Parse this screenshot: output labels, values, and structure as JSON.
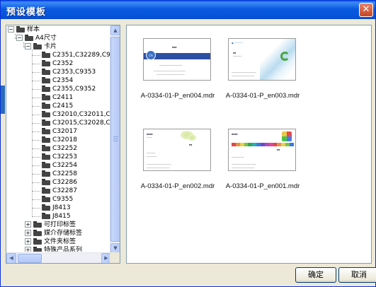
{
  "window": {
    "title": "预设模板",
    "close_icon": "close-icon"
  },
  "tree": {
    "root": "样本",
    "a4": "A4尺寸",
    "card": "卡片",
    "items": [
      "C2351,C32289,C9",
      "C2352",
      "C2353,C9353",
      "C2354",
      "C2355,C9352",
      "C2411",
      "C2415",
      "C32010,C32011,C",
      "C32015,C32028,C",
      "C32017",
      "C32018",
      "C32252",
      "C32253",
      "C32254",
      "C32258",
      "C32286",
      "C32287",
      "C9355",
      "J8413",
      "J8415"
    ],
    "categories": [
      "可打印标签",
      "媒介存储标签",
      "文件夹标签",
      "特殊产品系列"
    ]
  },
  "templates": [
    {
      "name": "A-0334-01-P_en004.mdr",
      "style": "blue"
    },
    {
      "name": "A-0334-01-P_en003.mdr",
      "style": "wave"
    },
    {
      "name": "A-0334-01-P_en002.mdr",
      "style": "leaf"
    },
    {
      "name": "A-0334-01-P_en001.mdr",
      "style": "colorbar"
    }
  ],
  "buttons": {
    "ok": "确定",
    "cancel": "取消"
  },
  "colors": {
    "titlebar": "#0552d8",
    "panel_border": "#7f9db9",
    "dialog_bg": "#ece9d8"
  }
}
